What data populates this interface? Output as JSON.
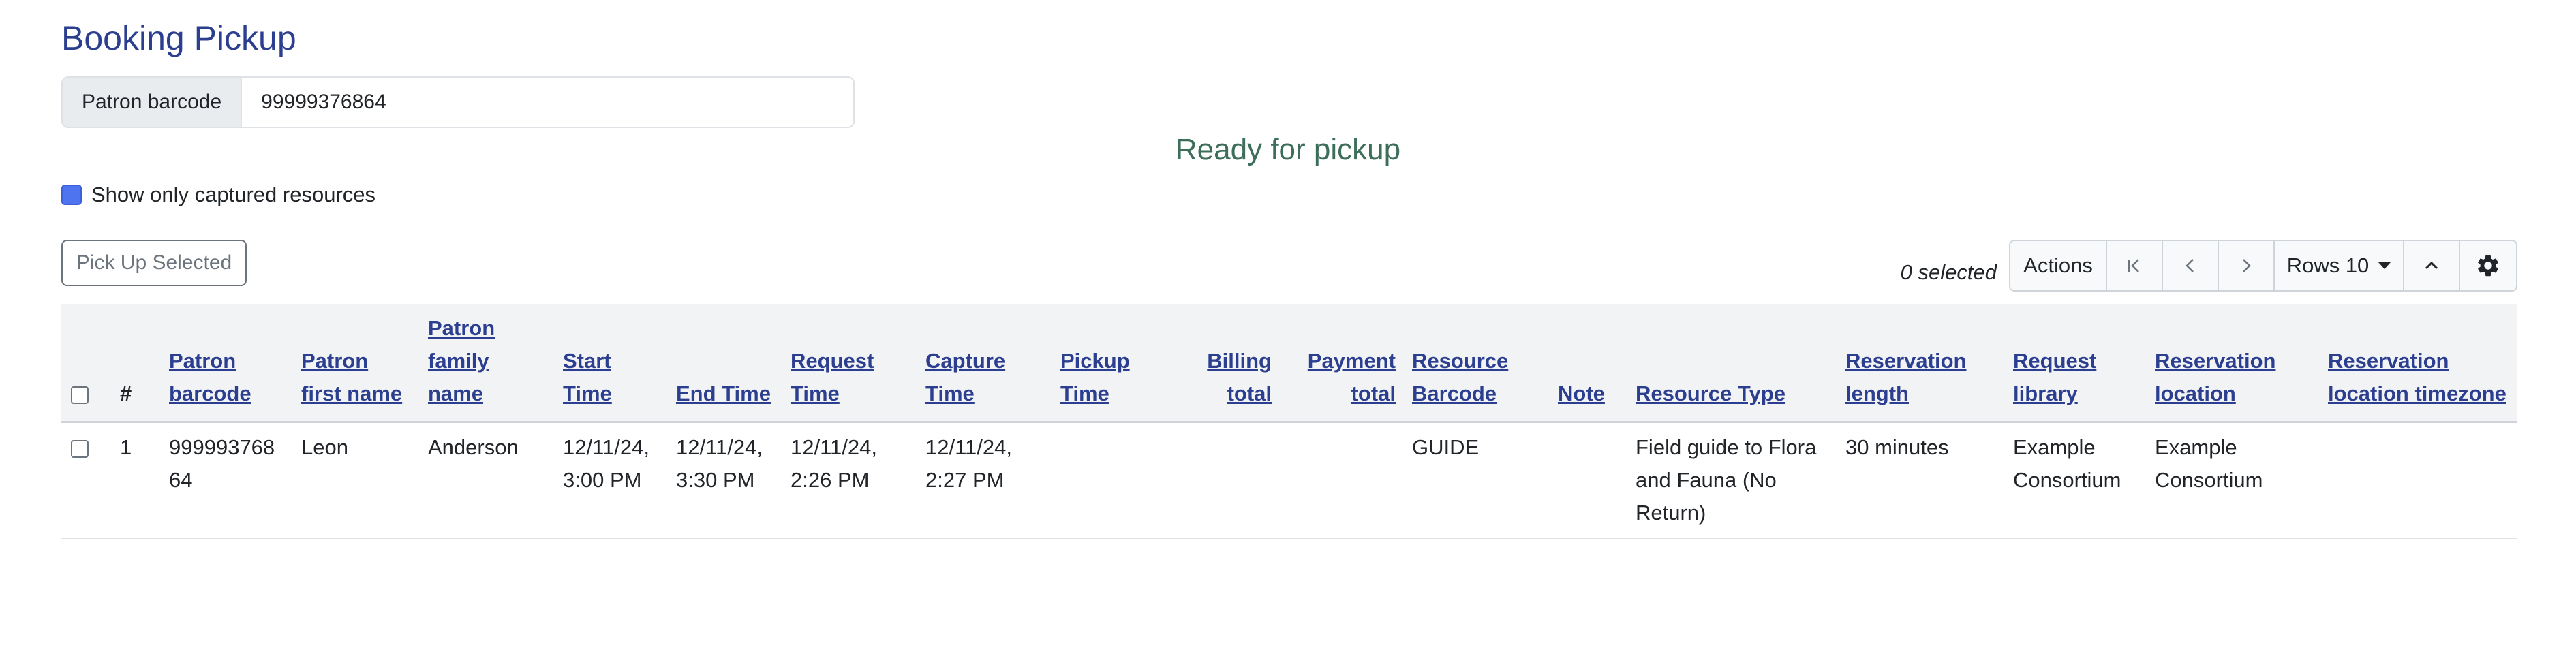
{
  "page": {
    "title": "Booking Pickup",
    "patron_barcode_label": "Patron barcode",
    "patron_barcode_value": "99999376864",
    "ready_heading": "Ready for pickup",
    "captured_label": "Show only captured resources",
    "pickup_button": "Pick Up Selected",
    "selected_count": "0 selected"
  },
  "toolbar": {
    "actions": "Actions",
    "rows": "Rows 10",
    "icons": [
      "first-page-icon",
      "previous-page-icon",
      "next-page-icon",
      "collapse-icon",
      "gear-icon"
    ]
  },
  "table": {
    "headers": [
      "#",
      "Patron barcode",
      "Patron first name",
      "Patron family name",
      "Start Time",
      "End Time",
      "Request Time",
      "Capture Time",
      "Pickup Time",
      "Billing total",
      "Payment total",
      "Resource Barcode",
      "Note",
      "Resource Type",
      "Reservation length",
      "Request library",
      "Reservation location",
      "Reservation location timezone"
    ],
    "rows": [
      {
        "index": "1",
        "patron_barcode": "99999376864",
        "first_name": "Leon",
        "family_name": "Anderson",
        "start_time": "12/11/24, 3:00 PM",
        "end_time": "12/11/24, 3:30 PM",
        "request_time": "12/11/24, 2:26 PM",
        "capture_time": "12/11/24, 2:27 PM",
        "pickup_time": "",
        "billing_total": "",
        "payment_total": "",
        "resource_barcode": "GUIDE",
        "note": "",
        "resource_type": "Field guide to Flora and Fauna (No Return)",
        "reservation_length": "30 minutes",
        "request_library": "Example Consortium",
        "reservation_location": "Example Consortium",
        "timezone": ""
      }
    ]
  },
  "colors": {
    "title": "#2c3e8f",
    "ready_heading": "#3c6e5a",
    "checkbox_checked": "#4f74f0"
  }
}
